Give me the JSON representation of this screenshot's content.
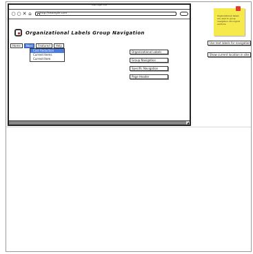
{
  "browser": {
    "title": "Web Page Title",
    "url": "http://example.com",
    "nav_buttons": [
      "back-icon",
      "forward-icon",
      "close-icon",
      "home-icon"
    ]
  },
  "page": {
    "headline": "Organizational Labels Group Navigation"
  },
  "nav_tabs": [
    {
      "label": "Home"
    },
    {
      "label": "Next",
      "active": true
    },
    {
      "label": "Featured"
    },
    {
      "label": "Help"
    }
  ],
  "dropdown": {
    "items": [
      {
        "label": "Cost Reduction",
        "selected": true
      },
      {
        "label": "Current Items"
      },
      {
        "label": "Current Item"
      }
    ]
  },
  "side_links": [
    {
      "label": "Organizational Labels"
    },
    {
      "label": "Group Navigation"
    },
    {
      "label": "Specific Navigation"
    },
    {
      "label": "Page Header"
    }
  ],
  "sticky_note": {
    "text": "Organizational labels are used to group navigation into logical sections."
  },
  "annotations": [
    {
      "label": "Use text labels for navigation"
    },
    {
      "label": "Show current location in site"
    }
  ],
  "colors": {
    "active_tab": "#4a7be0",
    "sticky": "#f6e94b",
    "pin": "#e23a2e"
  }
}
